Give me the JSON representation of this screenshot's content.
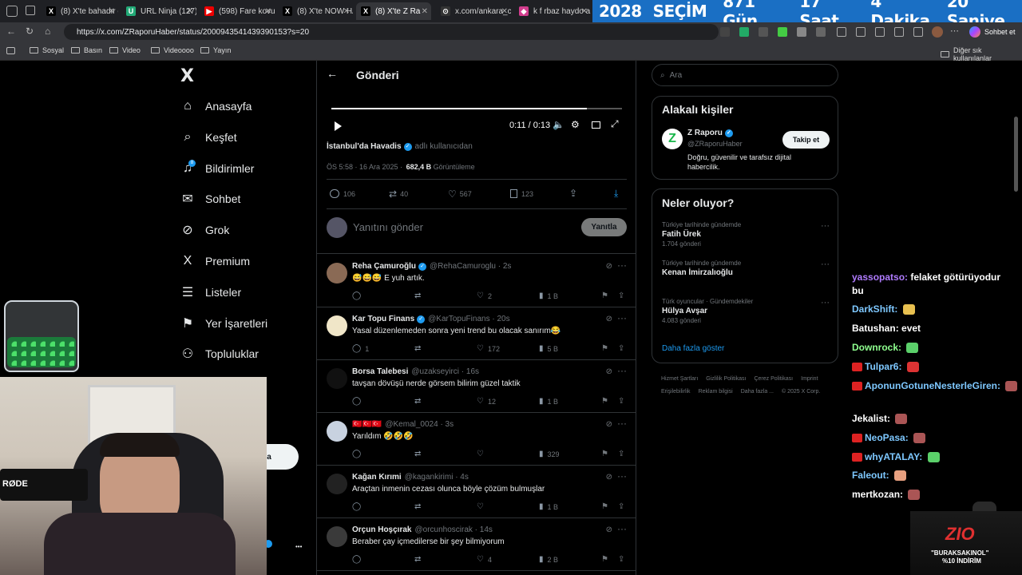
{
  "browser": {
    "tabs": [
      {
        "label": "(8) X'te bahadır e",
        "fav": "X"
      },
      {
        "label": "URL Ninja (127)",
        "fav": "U"
      },
      {
        "label": "(598) Fare kovucu",
        "fav": "▶"
      },
      {
        "label": "(8) X'te NOW HA",
        "fav": "X"
      },
      {
        "label": "(8) X'te Z Ra",
        "fav": "X"
      },
      {
        "label": "x.com/ankara_ce",
        "fav": "⊙"
      },
      {
        "label": "k f rbaz haydo a",
        "fav": "◆"
      }
    ],
    "countdown": {
      "year": "2028",
      "label": "SEÇİM",
      "days": "871 Gün",
      "hours": "17 Saat",
      "minutes": "4  Dakika",
      "seconds": "20 Saniye"
    },
    "url": "https://x.com/ZRaporuHaber/status/2000943541439390153?s=20",
    "chat_button": "Sohbet et",
    "bookmarks": [
      "Sosyal",
      "Basın",
      "Video",
      "Videoooo",
      "Yayın"
    ],
    "other_bookmarks": "Diğer sık kullanılanlar"
  },
  "sidebar": {
    "logo": "X",
    "items": [
      {
        "label": "Anasayfa",
        "icon": "home-icon",
        "glyph": "⌂"
      },
      {
        "label": "Keşfet",
        "icon": "search-icon",
        "glyph": "⌕"
      },
      {
        "label": "Bildirimler",
        "icon": "bell-icon",
        "glyph": "♫"
      },
      {
        "label": "Sohbet",
        "icon": "mail-icon",
        "glyph": "✉"
      },
      {
        "label": "Grok",
        "icon": "grok-icon",
        "glyph": "⊘"
      },
      {
        "label": "Premium",
        "icon": "x-premium-icon",
        "glyph": "X"
      },
      {
        "label": "Listeler",
        "icon": "list-icon",
        "glyph": "☰"
      },
      {
        "label": "Yer İşaretleri",
        "icon": "bookmark-icon",
        "glyph": "⚑"
      },
      {
        "label": "Topluluklar",
        "icon": "communities-icon",
        "glyph": "⚇"
      }
    ],
    "notification_count": "8",
    "post_button_partial": "a",
    "more_glyph": "•••"
  },
  "post": {
    "header_title": "Gönderi",
    "video_time": "0:11 / 0:13",
    "video_progress": 0.88,
    "source": "İstanbul'da Havadis",
    "source_suffix": "adlı kullanıcıdan",
    "time": "ÖS 5:58 · 16 Ara 2025 ·",
    "views": "682,4 B",
    "views_label": "Görüntüleme",
    "stats": {
      "replies": "106",
      "reposts": "40",
      "likes": "567",
      "bookmarks": "123"
    },
    "reply_placeholder": "Yanıtını gönder",
    "reply_button": "Yanıtla"
  },
  "replies": [
    {
      "name": "Reha Çamuroğlu",
      "verified": true,
      "handle": "@RehaCamuroglu · 2s",
      "text": "😅😅😅 E yuh artık.",
      "reply": "",
      "repost": "",
      "like": "2",
      "views": "1 B"
    },
    {
      "name": "Kar Topu Finans",
      "verified": true,
      "handle": "@KarTopuFinans · 20s",
      "text": "Yasal düzenlemeden sonra yeni trend bu olacak sanırım😂",
      "reply": "1",
      "repost": "",
      "like": "172",
      "views": "5 B"
    },
    {
      "name": "Borsa Talebesi",
      "verified": false,
      "handle": "@uzakseyirci · 16s",
      "text": "tavşan dövüşü nerde görsem bilirim güzel taktik",
      "reply": "",
      "repost": "",
      "like": "12",
      "views": "1 B"
    },
    {
      "name": "🇹🇷🇹🇷🇹🇷",
      "verified": false,
      "handle": "@Kemal_0024 · 3s",
      "text": "Yarıldım 🤣🤣🤣",
      "reply": "",
      "repost": "",
      "like": "",
      "views": "329"
    },
    {
      "name": "Kağan Kırımi",
      "verified": false,
      "handle": "@kagankirimi · 4s",
      "text": "Araçtan inmenin cezası olunca böyle çözüm bulmuşlar",
      "reply": "",
      "repost": "",
      "like": "",
      "views": "1 B"
    },
    {
      "name": "Orçun Hoşçırak",
      "verified": false,
      "handle": "@orcunhoscirak · 14s",
      "text": "Beraber çay içmedilerse bir şey bilmiyorum",
      "reply": "",
      "repost": "",
      "like": "4",
      "views": "2 B"
    }
  ],
  "right": {
    "search_placeholder": "Ara",
    "related_title": "Alakalı kişiler",
    "related": {
      "name": "Z Raporu",
      "handle": "@ZRaporuHaber",
      "bio": "Doğru, güvenilir ve tarafsız dijital habercilik.",
      "follow": "Takip et"
    },
    "trends_title": "Neler oluyor?",
    "trends": [
      {
        "category": "Türkiye tarihinde gündemde",
        "name": "Fatih Ürek",
        "count": "1.704 gönderi"
      },
      {
        "category": "Türkiye tarihinde gündemde",
        "name": "Kenan İmirzalıoğlu",
        "count": ""
      },
      {
        "category": "Türk oyuncular · Gündemdekiler",
        "name": "Hülya Avşar",
        "count": "4.083 gönderi"
      }
    ],
    "show_more": "Daha fazla göster",
    "footer": [
      "Hizmet Şartları",
      "Gizlilik Politikası",
      "Çerez Politikası",
      "Imprint",
      "Erişilebilirlik",
      "Reklam bilgisi",
      "Daha fazla ...",
      "© 2025 X Corp."
    ]
  },
  "chat": [
    {
      "user": "yassopatso",
      "msg": "felaket götürüyodur",
      "msg2": "bu",
      "color": "#b07cff"
    },
    {
      "user": "DarkShift",
      "msg": "",
      "color": "#7ec8ff"
    },
    {
      "user": "Batushan",
      "msg": "evet",
      "color": "#ffffff"
    },
    {
      "user": "Downrock",
      "msg": "",
      "color": "#8fff8f"
    },
    {
      "user": "Tulpar6",
      "msg": "",
      "color": "#7ec8ff"
    },
    {
      "user": "AponunGotuneNesterleGiren",
      "msg": "",
      "color": "#7ec8ff"
    },
    {
      "user": "Jekalist",
      "msg": "",
      "color": "#ffffff"
    },
    {
      "user": "NeoPasa",
      "msg": "",
      "color": "#7ec8ff"
    },
    {
      "user": "whyATALAY",
      "msg": "",
      "color": "#7ec8ff"
    },
    {
      "user": "Faleout",
      "msg": "",
      "color": "#7ec8ff"
    },
    {
      "user": "mertkozan",
      "msg": "",
      "color": "#ffffff"
    }
  ],
  "overlay": {
    "mic_brand": "RØDE",
    "promo_logo": "ZIO",
    "promo_code": "\"BURAKSAKINOL\"",
    "promo_discount": "%10 İNDİRİM"
  },
  "colors": {
    "accent": "#1d9bf0",
    "countdown_bg": "#1a6fc4"
  }
}
